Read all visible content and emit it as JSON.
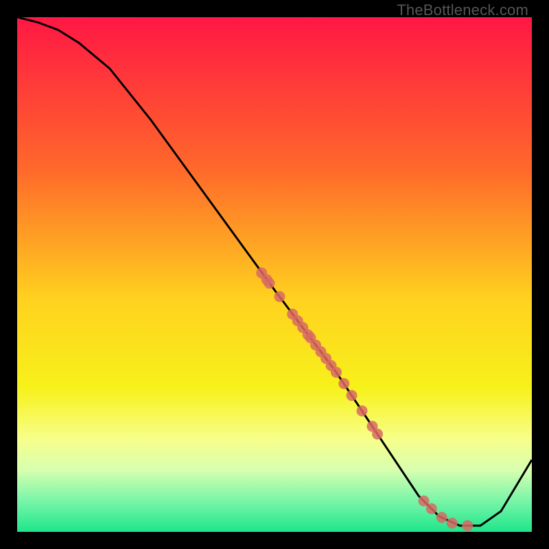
{
  "watermark": "TheBottleneck.com",
  "frame": {
    "outer_size_px": 800,
    "inner_size_px": 750,
    "border_px": 25,
    "border_color": "#000000"
  },
  "gradient": {
    "stops": [
      {
        "offset": 0.0,
        "color": "#ff1744"
      },
      {
        "offset": 0.3,
        "color": "#ff6a2a"
      },
      {
        "offset": 0.55,
        "color": "#ffd21f"
      },
      {
        "offset": 0.72,
        "color": "#f7f11a"
      },
      {
        "offset": 0.82,
        "color": "#f7ff8a"
      },
      {
        "offset": 0.88,
        "color": "#d7ffb0"
      },
      {
        "offset": 0.94,
        "color": "#78f5a8"
      },
      {
        "offset": 1.0,
        "color": "#1ee68c"
      }
    ]
  },
  "chart_data": {
    "type": "line",
    "title": "",
    "xlabel": "",
    "ylabel": "",
    "xlim": [
      0,
      100
    ],
    "ylim": [
      0,
      100
    ],
    "y_axis_inverted_visual": false,
    "note": "x/y are percentages of the plot area width/height measured from the bottom-left corner. The curve descends from upper-left, flattens near the bottom around x≈78–90, then rises toward the right edge.",
    "series": [
      {
        "name": "bottleneck-curve",
        "color": "#000000",
        "stroke_width_px": 3,
        "x": [
          0,
          4,
          8,
          12,
          18,
          26,
          34,
          42,
          50,
          56,
          62,
          66,
          70,
          74,
          78,
          82,
          86,
          90,
          94,
          97,
          100
        ],
        "y": [
          100,
          99,
          97.5,
          95,
          90,
          80,
          69,
          58,
          47,
          39,
          31,
          25,
          19,
          13,
          7,
          3,
          1.2,
          1.2,
          4,
          9,
          14
        ]
      }
    ],
    "scatter": {
      "name": "sample-points",
      "marker_color": "#d86a63",
      "marker_radius_px": 8,
      "note": "Points lie on the curve; values are (x%, y%).",
      "points": [
        {
          "x": 47.5,
          "y": 50.3
        },
        {
          "x": 48.5,
          "y": 49.0
        },
        {
          "x": 49.0,
          "y": 48.3
        },
        {
          "x": 51.0,
          "y": 45.7
        },
        {
          "x": 53.5,
          "y": 42.3
        },
        {
          "x": 54.5,
          "y": 41.0
        },
        {
          "x": 55.5,
          "y": 39.7
        },
        {
          "x": 56.5,
          "y": 38.3
        },
        {
          "x": 57.0,
          "y": 37.7
        },
        {
          "x": 58.0,
          "y": 36.3
        },
        {
          "x": 59.0,
          "y": 35.0
        },
        {
          "x": 60.0,
          "y": 33.7
        },
        {
          "x": 61.0,
          "y": 32.3
        },
        {
          "x": 62.0,
          "y": 31.0
        },
        {
          "x": 63.5,
          "y": 28.8
        },
        {
          "x": 65.0,
          "y": 26.5
        },
        {
          "x": 67.0,
          "y": 23.5
        },
        {
          "x": 69.0,
          "y": 20.5
        },
        {
          "x": 70.0,
          "y": 19.0
        },
        {
          "x": 79.0,
          "y": 6.0
        },
        {
          "x": 80.5,
          "y": 4.5
        },
        {
          "x": 82.5,
          "y": 2.8
        },
        {
          "x": 84.5,
          "y": 1.7
        },
        {
          "x": 87.5,
          "y": 1.2
        }
      ]
    }
  }
}
